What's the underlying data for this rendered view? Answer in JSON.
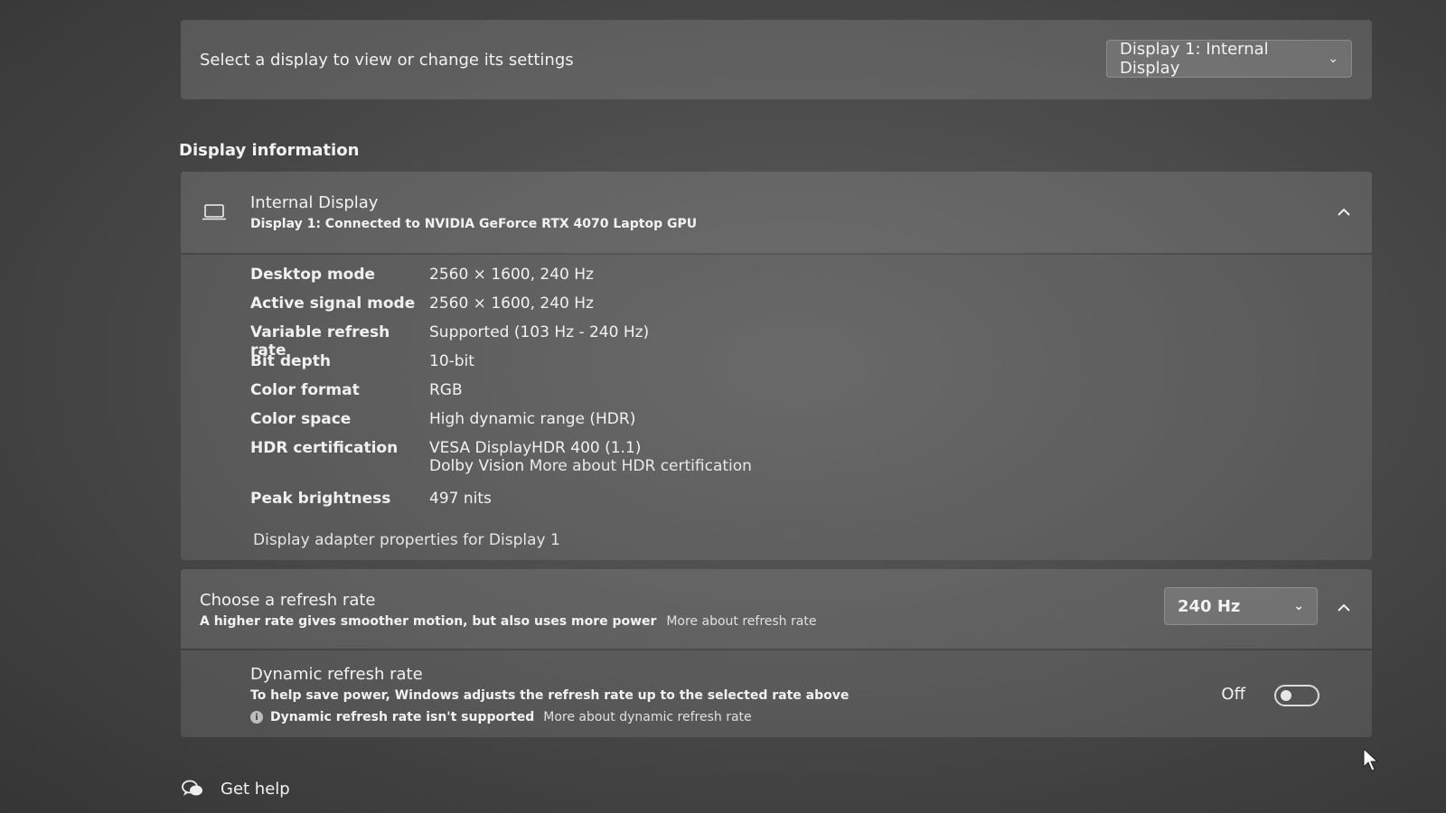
{
  "selector": {
    "label": "Select a display to view or change its settings",
    "selected_display": "Display 1: Internal Display"
  },
  "display_info": {
    "section_title": "Display information",
    "name": "Internal Display",
    "connection": "Display 1: Connected to NVIDIA GeForce RTX 4070 Laptop GPU",
    "properties": [
      {
        "key": "Desktop mode",
        "value": "2560 × 1600, 240 Hz"
      },
      {
        "key": "Active signal mode",
        "value": "2560 × 1600, 240 Hz"
      },
      {
        "key": "Variable refresh rate",
        "value": "Supported (103 Hz - 240 Hz)"
      },
      {
        "key": "Bit depth",
        "value": "10-bit"
      },
      {
        "key": "Color format",
        "value": "RGB"
      },
      {
        "key": "Color space",
        "value": "High dynamic range (HDR)"
      },
      {
        "key": "HDR certification",
        "value": "VESA DisplayHDR 400 (1.1)",
        "value2": "Dolby Vision",
        "link": "More about HDR certification"
      },
      {
        "key": "Peak brightness",
        "value": "497 nits"
      }
    ],
    "adapter_link": "Display adapter properties for Display 1"
  },
  "refresh_rate": {
    "title": "Choose a refresh rate",
    "description": "A higher rate gives smoother motion, but also uses more power",
    "more_link": "More about refresh rate",
    "selected": "240 Hz"
  },
  "dynamic_refresh": {
    "title": "Dynamic refresh rate",
    "description": "To help save power, Windows adjusts the refresh rate up to the selected rate above",
    "warning": "Dynamic refresh rate isn't supported",
    "more_link": "More about dynamic refresh rate",
    "toggle_state": "Off"
  },
  "help": {
    "label": "Get help"
  }
}
